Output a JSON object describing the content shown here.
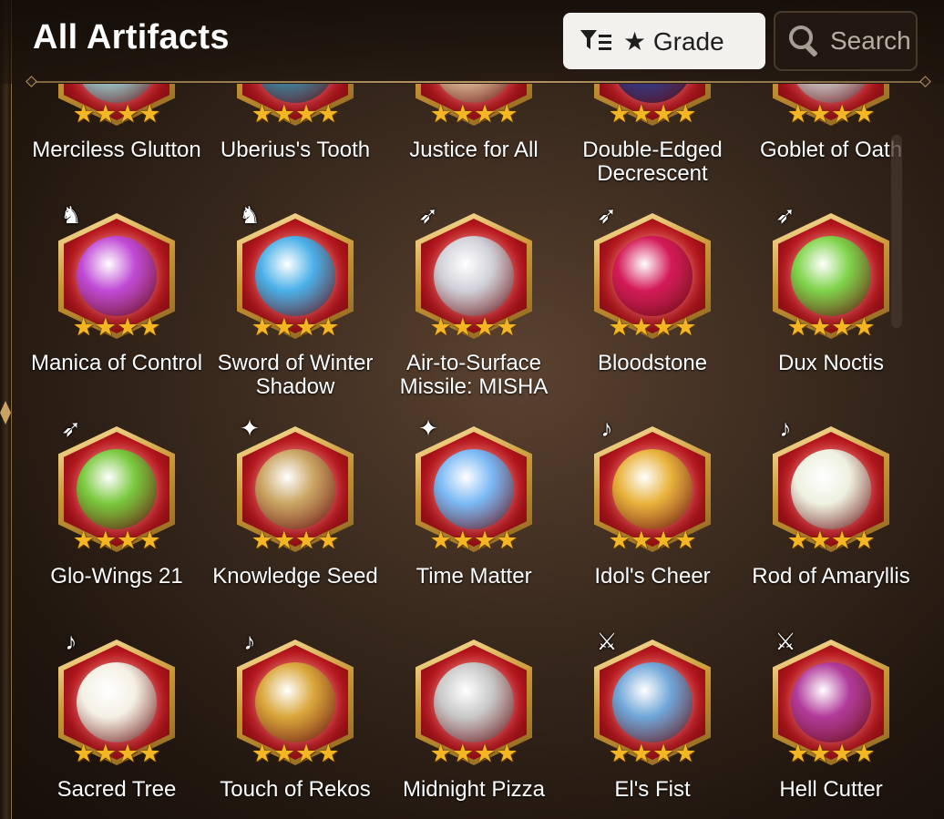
{
  "header": {
    "title": "All Artifacts",
    "grade_label": "★ Grade",
    "search_label": "Search"
  },
  "artifacts": [
    {
      "name": "Merciless Glutton",
      "stars": "★★★★",
      "class_icon": "",
      "color": "#9bd3d6"
    },
    {
      "name": "Uberius's Tooth",
      "stars": "★★★★",
      "class_icon": "",
      "color": "#3a8aa8"
    },
    {
      "name": "Justice for All",
      "stars": "★★★★",
      "class_icon": "",
      "color": "#e0c09a"
    },
    {
      "name": "Double-Edged Decrescent",
      "stars": "★★★★",
      "class_icon": "",
      "color": "#2b3a8a"
    },
    {
      "name": "Goblet of Oath",
      "stars": "★★★★",
      "class_icon": "",
      "color": "#cfcfcf"
    },
    {
      "name": "Manica of Control",
      "stars": "★★★★",
      "class_icon": "♞",
      "color": "#c04ad6"
    },
    {
      "name": "Sword of Winter Shadow",
      "stars": "★★★★",
      "class_icon": "♞",
      "color": "#4ab0e8"
    },
    {
      "name": "Air-to-Surface Missile: MISHA",
      "stars": "★★★★",
      "class_icon": "➶",
      "color": "#d0d0d8"
    },
    {
      "name": "Bloodstone",
      "stars": "★★★★",
      "class_icon": "➶",
      "color": "#d41a58"
    },
    {
      "name": "Dux Noctis",
      "stars": "★★★★",
      "class_icon": "➶",
      "color": "#7ed34a"
    },
    {
      "name": "Glo-Wings 21",
      "stars": "★★★★",
      "class_icon": "➶",
      "color": "#78c83c"
    },
    {
      "name": "Knowledge Seed",
      "stars": "★★★★",
      "class_icon": "✦",
      "color": "#c9a462"
    },
    {
      "name": "Time Matter",
      "stars": "★★★★",
      "class_icon": "✦",
      "color": "#7ab8f5"
    },
    {
      "name": "Idol's Cheer",
      "stars": "★★★★",
      "class_icon": "♪",
      "color": "#e8b23c"
    },
    {
      "name": "Rod of Amaryllis",
      "stars": "★★★★",
      "class_icon": "♪",
      "color": "#eef0e0"
    },
    {
      "name": "Sacred Tree",
      "stars": "★★★★",
      "class_icon": "♪",
      "color": "#f4f0e4"
    },
    {
      "name": "Touch of Rekos",
      "stars": "★★★★",
      "class_icon": "♪",
      "color": "#d9a63a"
    },
    {
      "name": "Midnight Pizza",
      "stars": "★★★★",
      "class_icon": "",
      "color": "#c8c8c8"
    },
    {
      "name": "El's Fist",
      "stars": "★★★★",
      "class_icon": "⚔",
      "color": "#6fa6d8"
    },
    {
      "name": "Hell Cutter",
      "stars": "★★★★",
      "class_icon": "⚔",
      "color": "#b13a9a"
    }
  ]
}
